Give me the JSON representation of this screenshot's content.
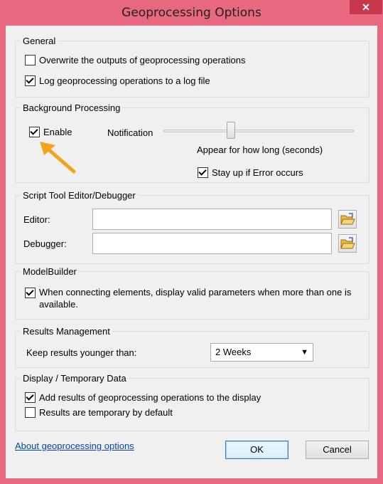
{
  "window": {
    "title": "Geoprocessing Options",
    "close_glyph": "✕"
  },
  "general": {
    "title": "General",
    "overwrite": {
      "label": "Overwrite the outputs of geoprocessing operations",
      "checked": false
    },
    "log": {
      "label": "Log geoprocessing operations to a log file",
      "checked": true
    }
  },
  "background": {
    "title": "Background Processing",
    "enable": {
      "label": "Enable",
      "checked": true
    },
    "notification_label": "Notification",
    "slider_caption": "Appear for how long (seconds)",
    "stay_up": {
      "label": "Stay up if Error occurs",
      "checked": true
    }
  },
  "script_tool": {
    "title": "Script Tool Editor/Debugger",
    "editor_label": "Editor:",
    "editor_value": "",
    "debugger_label": "Debugger:",
    "debugger_value": ""
  },
  "modelbuilder": {
    "title": "ModelBuilder",
    "valid_params": {
      "label_line1": "When connecting elements, display valid parameters when more than one is",
      "label_line2": "available.",
      "checked": true
    }
  },
  "results": {
    "title": "Results Management",
    "keep_label": "Keep results younger than:",
    "keep_value": "2 Weeks"
  },
  "display": {
    "title": "Display / Temporary Data",
    "add_results": {
      "label": "Add results of geoprocessing operations to the display",
      "checked": true
    },
    "temporary": {
      "label": "Results are temporary by default",
      "checked": false
    }
  },
  "footer": {
    "about_link": "About geoprocessing options",
    "ok_label": "OK",
    "cancel_label": "Cancel"
  },
  "colors": {
    "frame": "#e8697f",
    "close": "#c7384c",
    "annotation_arrow": "#f2a31b"
  }
}
